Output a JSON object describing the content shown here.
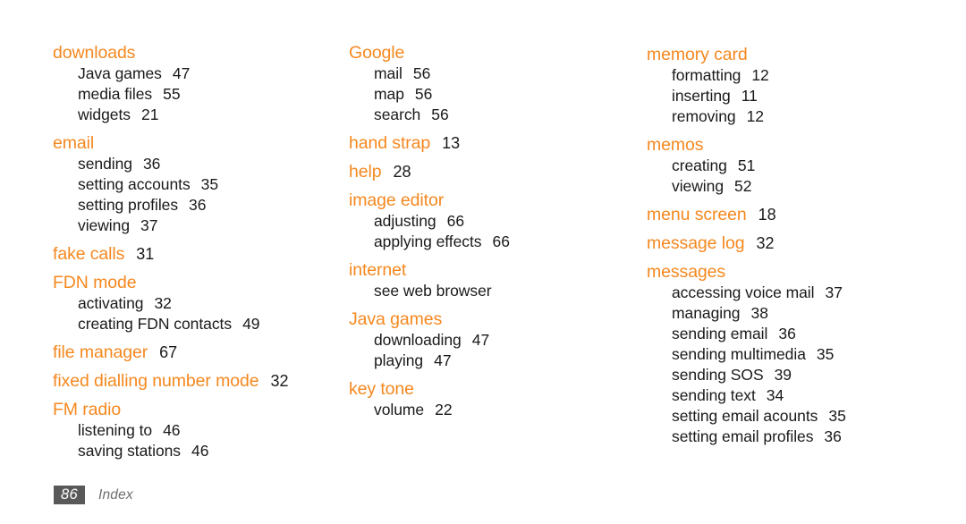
{
  "page": {
    "background_color": "#ffffff",
    "heading_color": "#f5881f",
    "text_color": "#1a1a1a",
    "folio_box_color": "#595959",
    "folio_label_color": "#6e6e6e"
  },
  "footer": {
    "page_number": "86",
    "section_label": "Index"
  },
  "columns": [
    {
      "groups": [
        {
          "term": "downloads",
          "page": "",
          "entries": [
            {
              "term": "Java games",
              "page": "47"
            },
            {
              "term": "media files",
              "page": "55"
            },
            {
              "term": "widgets",
              "page": "21"
            }
          ]
        },
        {
          "term": "email",
          "page": "",
          "entries": [
            {
              "term": "sending",
              "page": "36"
            },
            {
              "term": "setting accounts",
              "page": "35"
            },
            {
              "term": "setting profiles",
              "page": "36"
            },
            {
              "term": "viewing",
              "page": "37"
            }
          ]
        },
        {
          "term": "fake calls",
          "page": "31",
          "entries": []
        },
        {
          "term": "FDN mode",
          "page": "",
          "entries": [
            {
              "term": "activating",
              "page": "32"
            },
            {
              "term": "creating FDN contacts",
              "page": "49"
            }
          ]
        },
        {
          "term": "file manager",
          "page": "67",
          "entries": []
        },
        {
          "term": "fixed dialling number mode",
          "page": "32",
          "entries": []
        },
        {
          "term": "FM radio",
          "page": "",
          "entries": [
            {
              "term": "listening to",
              "page": "46"
            },
            {
              "term": "saving stations",
              "page": "46"
            }
          ]
        }
      ]
    },
    {
      "groups": [
        {
          "term": "Google",
          "page": "",
          "entries": [
            {
              "term": "mail",
              "page": "56"
            },
            {
              "term": "map",
              "page": "56"
            },
            {
              "term": "search",
              "page": "56"
            }
          ]
        },
        {
          "term": "hand strap",
          "page": "13",
          "entries": []
        },
        {
          "term": "help",
          "page": "28",
          "entries": []
        },
        {
          "term": "image editor",
          "page": "",
          "entries": [
            {
              "term": "adjusting",
              "page": "66"
            },
            {
              "term": "applying effects",
              "page": "66"
            }
          ]
        },
        {
          "term": "internet",
          "page": "",
          "entries": [
            {
              "term": "see web browser",
              "page": ""
            }
          ]
        },
        {
          "term": "Java games",
          "page": "",
          "entries": [
            {
              "term": "downloading",
              "page": "47"
            },
            {
              "term": "playing",
              "page": "47"
            }
          ]
        },
        {
          "term": "key tone",
          "page": "",
          "entries": [
            {
              "term": "volume",
              "page": "22"
            }
          ]
        }
      ]
    },
    {
      "groups": [
        {
          "term": "memory card",
          "page": "",
          "entries": [
            {
              "term": "formatting",
              "page": "12"
            },
            {
              "term": "inserting",
              "page": "11"
            },
            {
              "term": "removing",
              "page": "12"
            }
          ]
        },
        {
          "term": "memos",
          "page": "",
          "entries": [
            {
              "term": "creating",
              "page": "51"
            },
            {
              "term": "viewing",
              "page": "52"
            }
          ]
        },
        {
          "term": "menu screen",
          "page": "18",
          "entries": []
        },
        {
          "term": "message log",
          "page": "32",
          "entries": []
        },
        {
          "term": "messages",
          "page": "",
          "entries": [
            {
              "term": "accessing voice mail",
              "page": "37"
            },
            {
              "term": "managing",
              "page": "38"
            },
            {
              "term": "sending email",
              "page": "36"
            },
            {
              "term": "sending multimedia",
              "page": "35"
            },
            {
              "term": "sending SOS",
              "page": "39"
            },
            {
              "term": "sending text",
              "page": "34"
            },
            {
              "term": "setting email acounts",
              "page": "35"
            },
            {
              "term": "setting email profiles",
              "page": "36"
            }
          ]
        }
      ]
    }
  ]
}
